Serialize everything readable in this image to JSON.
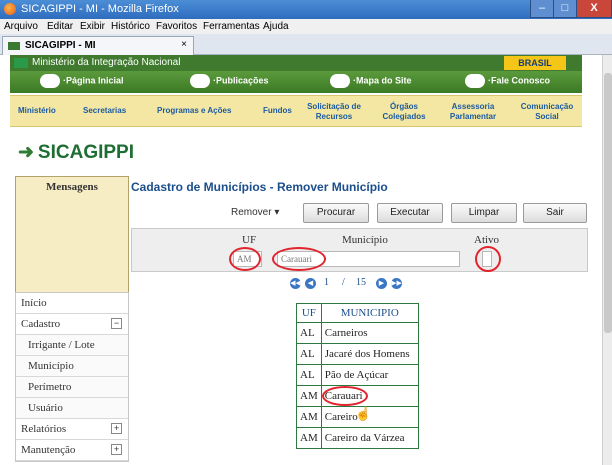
{
  "window": {
    "title": "SICAGIPPI - MI - Mozilla Firefox",
    "minimize": "–",
    "maximize": "□",
    "close": "X"
  },
  "menubar": [
    "Arquivo",
    "Editar",
    "Exibir",
    "Histórico",
    "Favoritos",
    "Ferramentas",
    "Ajuda"
  ],
  "tab": {
    "label": "SICAGIPPI - MI",
    "close": "×"
  },
  "gov": {
    "label": "Ministério da Integração Nacional",
    "logo": "BRASIL"
  },
  "nav1": [
    "·Página Inicial",
    "·Publicações",
    "·Mapa do Site",
    "·Fale Conosco"
  ],
  "nav2": [
    "Ministério",
    "Secretarias",
    "Programas e Ações",
    "Fundos",
    "Solicitação de Recursos",
    "Órgãos Colegiados",
    "Assessoria Parlamentar",
    "Comunicação Social"
  ],
  "brand": {
    "arrow": "➜",
    "name": "SICAGIPPI"
  },
  "mensagens": "Mensagens",
  "menu": [
    {
      "label": "Início",
      "sub": false,
      "pm": ""
    },
    {
      "label": "Cadastro",
      "sub": false,
      "pm": "−"
    },
    {
      "label": "Irrigante / Lote",
      "sub": true,
      "pm": ""
    },
    {
      "label": "Município",
      "sub": true,
      "pm": ""
    },
    {
      "label": "Perímetro",
      "sub": true,
      "pm": ""
    },
    {
      "label": "Usuário",
      "sub": true,
      "pm": ""
    },
    {
      "label": "Relatórios",
      "sub": false,
      "pm": "+"
    },
    {
      "label": "Manutenção",
      "sub": false,
      "pm": "+"
    }
  ],
  "page_title": "Cadastro de Municípios - Remover Município",
  "toolbar": {
    "action": "Remover",
    "procurar": "Procurar",
    "executar": "Executar",
    "limpar": "Limpar",
    "sair": "Sair"
  },
  "filter": {
    "uf_label": "UF",
    "municipio_label": "Município",
    "ativo_label": "Ativo",
    "uf_value": "AM",
    "municipio_value": "Carauari"
  },
  "pager": {
    "current": "1",
    "separator": "/",
    "total": "15"
  },
  "table": {
    "headers": [
      "UF",
      "MUNICIPIO"
    ],
    "rows": [
      [
        "AL",
        "Carneiros"
      ],
      [
        "AL",
        "Jacaré dos Homens"
      ],
      [
        "AL",
        "Pão de Açúcar"
      ],
      [
        "AM",
        "Carauari"
      ],
      [
        "AM",
        "Careiro"
      ],
      [
        "AM",
        "Careiro da Várzea"
      ]
    ]
  }
}
